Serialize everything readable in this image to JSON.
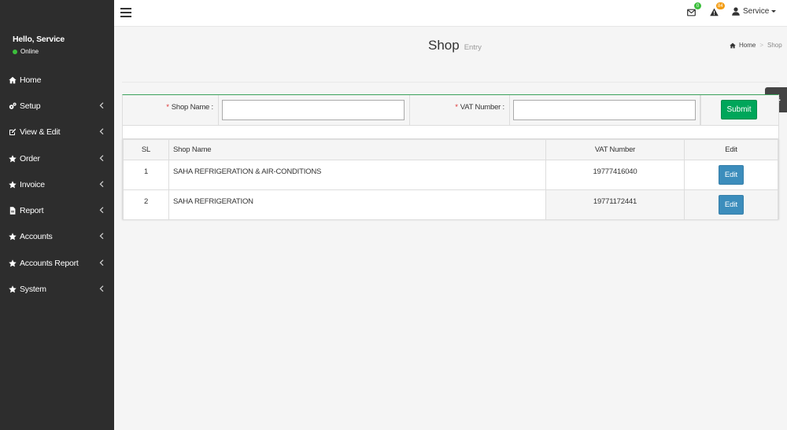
{
  "sidebar": {
    "user_greeting": "Hello, Service",
    "user_status": "Online",
    "items": [
      {
        "label": "Home",
        "icon": "home-icon"
      },
      {
        "label": "Setup",
        "icon": "cogs-icon"
      },
      {
        "label": "View & Edit",
        "icon": "edit-icon"
      },
      {
        "label": "Order",
        "icon": "star-icon"
      },
      {
        "label": "Invoice",
        "icon": "star-icon"
      },
      {
        "label": "Report",
        "icon": "file-icon"
      },
      {
        "label": "Accounts",
        "icon": "star-icon"
      },
      {
        "label": "Accounts Report",
        "icon": "star-icon"
      },
      {
        "label": "System",
        "icon": "star-icon"
      }
    ]
  },
  "header": {
    "mail_count": "0",
    "alert_count": "84",
    "user_label": "Service"
  },
  "page": {
    "title": "Shop",
    "subtitle": "Entry",
    "breadcrumb_home": "Home",
    "breadcrumb_sep": ">",
    "breadcrumb_current": "Shop"
  },
  "form": {
    "shop_name_label": "Shop Name :",
    "shop_name_value": "",
    "vat_label": "VAT Number :",
    "vat_value": "",
    "required_mark": "*",
    "submit_label": "Submit"
  },
  "table": {
    "headers": {
      "sl": "SL",
      "name": "Shop Name",
      "vat": "VAT Number",
      "edit": "Edit"
    },
    "rows": [
      {
        "sl": "1",
        "name": "SAHA REFRIGERATION & AIR-CONDITIONS",
        "vat": "19777416040",
        "edit": "Edit"
      },
      {
        "sl": "2",
        "name": "SAHA REFRIGERATION",
        "vat": "19771172441",
        "edit": "Edit"
      }
    ]
  },
  "colors": {
    "sidebar_bg": "#2d2d2d",
    "submit_green": "#00a65a",
    "edit_blue": "#3c8dbc",
    "badge_green": "#3cbf3c",
    "badge_orange": "#f39c12"
  }
}
